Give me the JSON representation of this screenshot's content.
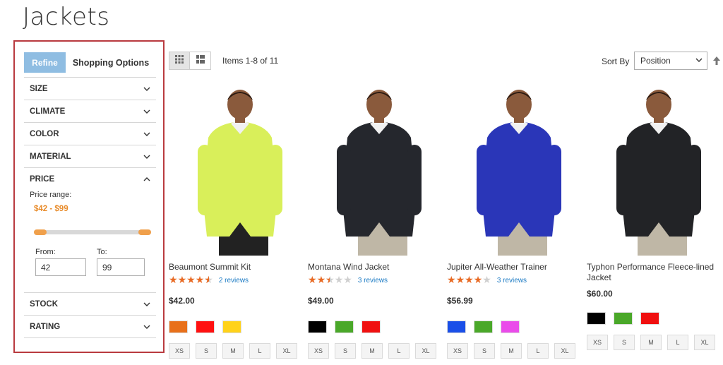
{
  "page": {
    "title": "Jackets"
  },
  "sidebar": {
    "tabs": {
      "refine": "Refine",
      "shopping_options": "Shopping Options"
    },
    "filters": [
      {
        "label": "SIZE"
      },
      {
        "label": "CLIMATE"
      },
      {
        "label": "COLOR"
      },
      {
        "label": "MATERIAL"
      }
    ],
    "price": {
      "label": "PRICE",
      "range_label": "Price range:",
      "range_value": "$42 - $99",
      "from_label": "From:",
      "to_label": "To:",
      "from_value": "42",
      "to_value": "99"
    },
    "filters_after": [
      {
        "label": "STOCK"
      },
      {
        "label": "RATING"
      }
    ]
  },
  "toolbar": {
    "items_count": "Items 1-8 of 11",
    "sort_label": "Sort By",
    "sort_value": "Position"
  },
  "products": [
    {
      "name": "Beaumont Summit Kit",
      "rating": 4.5,
      "reviews": "2 reviews",
      "price": "$42.00",
      "jacket_color": "#d9ef5a",
      "swatches": [
        "#e8701a",
        "#ff1010",
        "#ffd21a"
      ],
      "sizes": [
        "XS",
        "S",
        "M",
        "L",
        "XL"
      ]
    },
    {
      "name": "Montana Wind Jacket",
      "rating": 2.5,
      "reviews": "3 reviews",
      "price": "$49.00",
      "jacket_color": "#25272d",
      "swatches": [
        "#000000",
        "#4aa829",
        "#f01010"
      ],
      "sizes": [
        "XS",
        "S",
        "M",
        "L",
        "XL"
      ]
    },
    {
      "name": "Jupiter All-Weather Trainer",
      "rating": 4,
      "reviews": "3 reviews",
      "price": "$56.99",
      "jacket_color": "#2a36b8",
      "swatches": [
        "#1a4fe8",
        "#4aa829",
        "#ea4bea"
      ],
      "sizes": [
        "XS",
        "S",
        "M",
        "L",
        "XL"
      ]
    },
    {
      "name": "Typhon Performance Fleece-lined Jacket",
      "rating": null,
      "reviews": "",
      "price": "$60.00",
      "jacket_color": "#222326",
      "swatches": [
        "#000000",
        "#4aa829",
        "#f01010"
      ],
      "sizes": [
        "XS",
        "S",
        "M",
        "L",
        "XL"
      ]
    }
  ]
}
